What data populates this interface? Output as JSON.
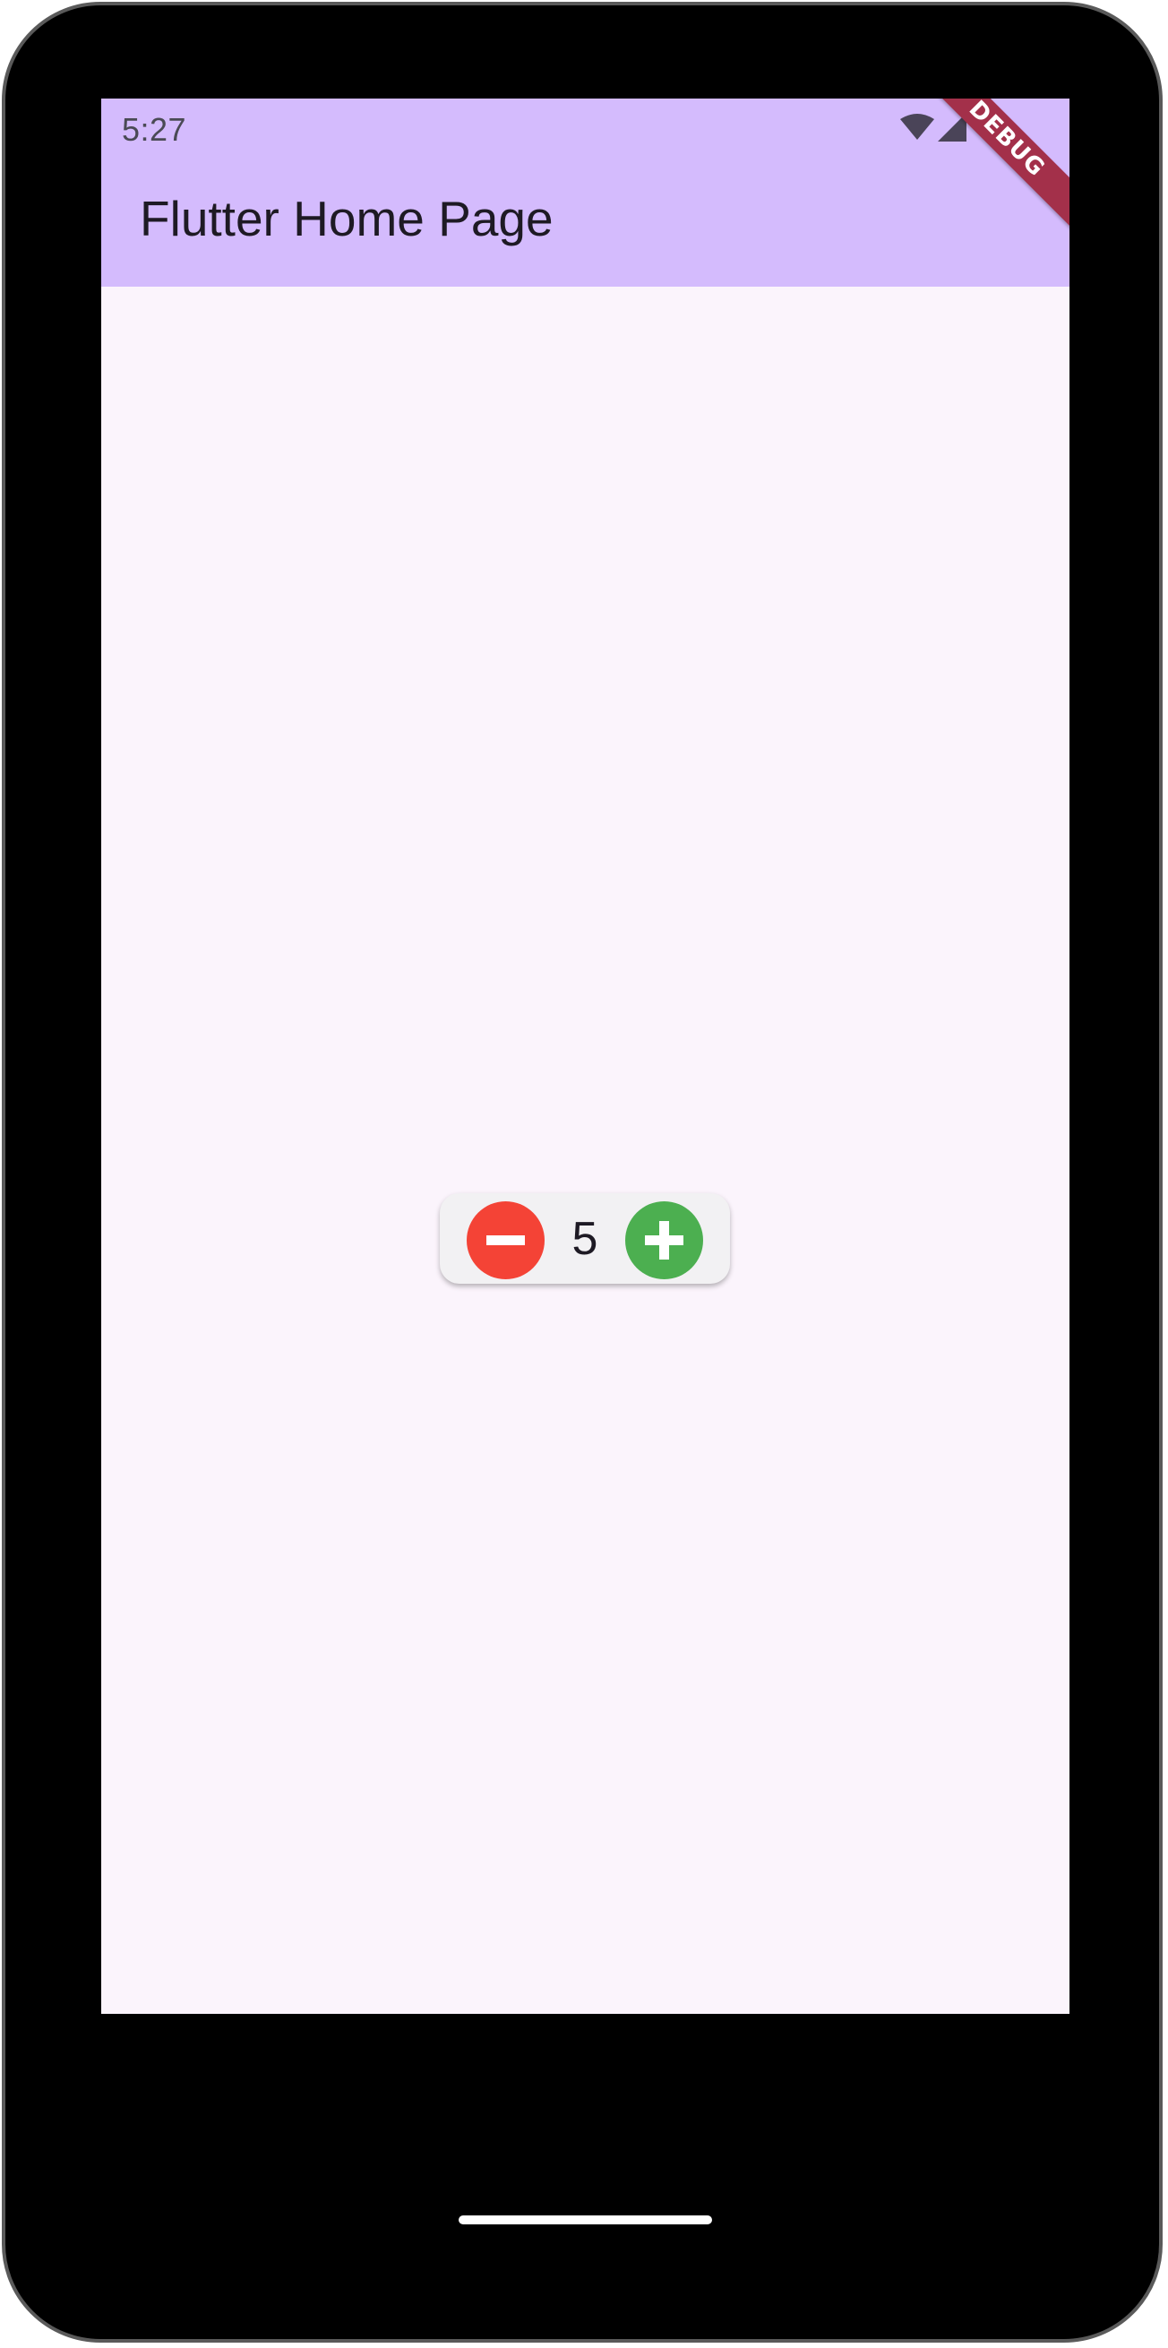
{
  "status_bar": {
    "time": "5:27",
    "icons": [
      "wifi-icon",
      "cellular-signal-icon"
    ]
  },
  "app_bar": {
    "title": "Flutter Home Page",
    "background_color": "#d4bbfd"
  },
  "debug_banner": {
    "label": "DEBUG",
    "color": "#a3304a"
  },
  "counter": {
    "value": "5",
    "decrement_icon": "minus-icon",
    "increment_icon": "plus-icon",
    "decrement_color": "#f44336",
    "increment_color": "#4caf50"
  },
  "colors": {
    "screen_background": "#fbf4fc",
    "device_frame": "#000000"
  }
}
